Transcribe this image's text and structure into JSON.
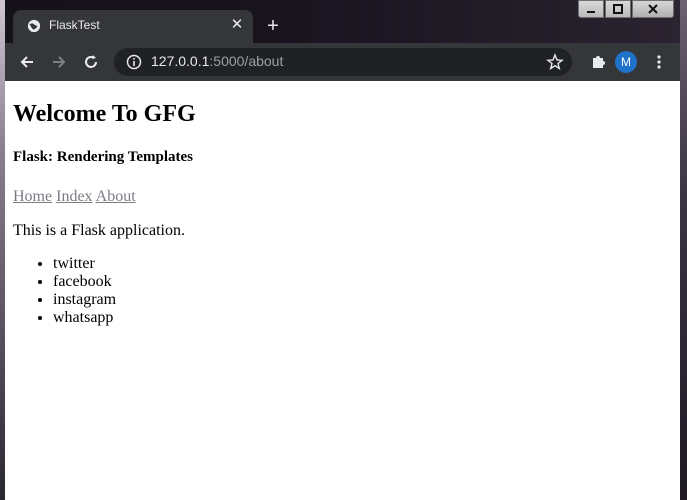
{
  "browser": {
    "tab_title": "FlaskTest",
    "close_tab_glyph": "✕",
    "new_tab_glyph": "+",
    "url_host": "127.0.0.1",
    "url_rest": ":5000/about",
    "profile_initial": "M"
  },
  "icons": {
    "window_minimize": "minimize-icon",
    "window_maximize": "maximize-icon",
    "window_close": "close-window-icon",
    "back": "back-arrow-icon",
    "forward": "forward-arrow-icon",
    "reload": "reload-icon",
    "site_info": "info-icon",
    "bookmark": "star-icon",
    "extensions": "puzzle-icon",
    "menu": "kebab-menu-icon",
    "favicon": "globe-icon"
  },
  "colors": {
    "tab_bg": "#35363a",
    "omnibox_bg": "#202124",
    "avatar_bg": "#1e72c8"
  },
  "page": {
    "heading": "Welcome To GFG",
    "subheading": "Flask: Rendering Templates",
    "nav_links": [
      "Home",
      "Index",
      "About"
    ],
    "paragraph": "This is a Flask application.",
    "list_items": [
      "twitter",
      "facebook",
      "instagram",
      "whatsapp"
    ]
  }
}
